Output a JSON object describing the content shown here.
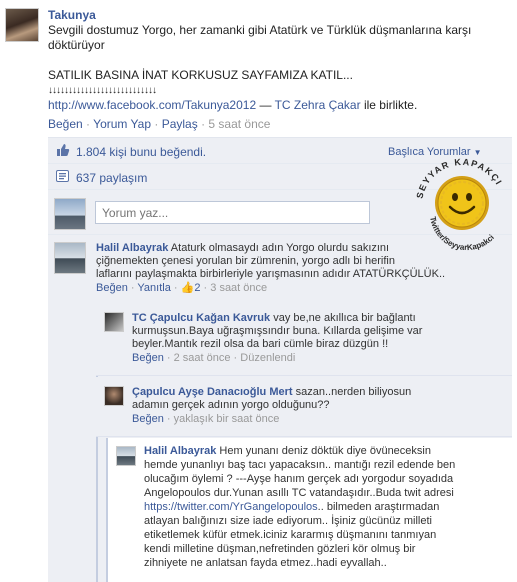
{
  "post": {
    "author": "Takunya",
    "text_line1": "Sevgili dostumuz Yorgo, her zamanki gibi Atatürk ve Türklük düşmanlarına karşı",
    "text_line2": "döktürüyor",
    "text_line3": "SATILIK BASINA İNAT KORKUSUZ SAYFAMIZA KATIL...",
    "arrows": "↓↓↓↓↓↓↓↓↓↓↓↓↓↓↓↓↓↓↓↓↓↓↓↓↓↓↓",
    "link": "http://www.facebook.com/Takunya2012",
    "with_prefix": " — ",
    "with_name": "TC Zehra Çakar",
    "with_suffix": " ile birlikte.",
    "actions": {
      "like": "Beğen",
      "comment": "Yorum Yap",
      "share": "Paylaş",
      "time": "5 saat önce"
    }
  },
  "ufi": {
    "likes": "1.804 kişi bunu beğendi.",
    "sort_label": "Başlıca Yorumlar",
    "shares": "637 paylaşım",
    "comment_placeholder": "Yorum yaz..."
  },
  "watermark": {
    "top_text": "SEYYAR KAPAKÇI",
    "bottom_text": "Twitter/SeyyarKapakci"
  },
  "comments": [
    {
      "author": "Halil Albayrak",
      "line1": " Ataturk olmasaydı adın Yorgo olurdu sakızını",
      "line2": "çiğnemekten çenesi yorulan bir zümrenin, yorgo adlı bi herifin",
      "line3": "laflarını paylaşmakta birbirleriyle yarışmasının adıdır ATATÜRKÇÜLÜK..",
      "like": "Beğen",
      "reply": "Yanıtla",
      "like_count": "2",
      "time": "3 saat önce"
    },
    {
      "author": "TC Çapulcu Kağan Kavruk",
      "line1": " vay be,ne akıllıca bir bağlantı",
      "line2": "kurmuşsun.Baya uğraşmışsındır buna. Kıllarda gelişime var",
      "line3": "beyler.Mantık rezil olsa da bari cümle biraz düzgün !!",
      "like": "Beğen",
      "time": "2 saat önce",
      "edited": "Düzenlendi"
    },
    {
      "author": "Çapulcu Ayşe Danacıoğlu Mert",
      "line1": " sazan..nerden biliyosun",
      "line2": "adamın gerçek adının yorgo olduğunu??",
      "like": "Beğen",
      "time": "yaklaşık bir saat önce"
    },
    {
      "author": "Halil Albayrak",
      "line1": " Hem yunanı deniz döktük diye övüneceksin",
      "line2": "hemde yunanlıyı baş tacı yapacaksın.. mantığı rezil edende ben",
      "line3": "olucağım öylemi ? ---Ayşe hanım gerçek adı yorgodur soyadıda",
      "line4": "Angelopoulos dur.Yunan asıllı TC vatandaşıdır..Buda twit adresi",
      "line5_link": "https://twitter.com/YrGangelopoulos",
      "line5_rest": ".. bilmeden araştırmadan",
      "line6": "atlayan balığınızı size iade ediyorum.. İşiniz gücünüz milleti",
      "line7": "etiketlemek küfür etmek.iciniz kararmış düşmanını tanmıyan",
      "line8": "kendi milletine düşman,nefretinden gözleri kör olmuş bir",
      "line9": "zihniyete ne anlatsan fayda etmez..hadi eyvallah.."
    }
  ]
}
